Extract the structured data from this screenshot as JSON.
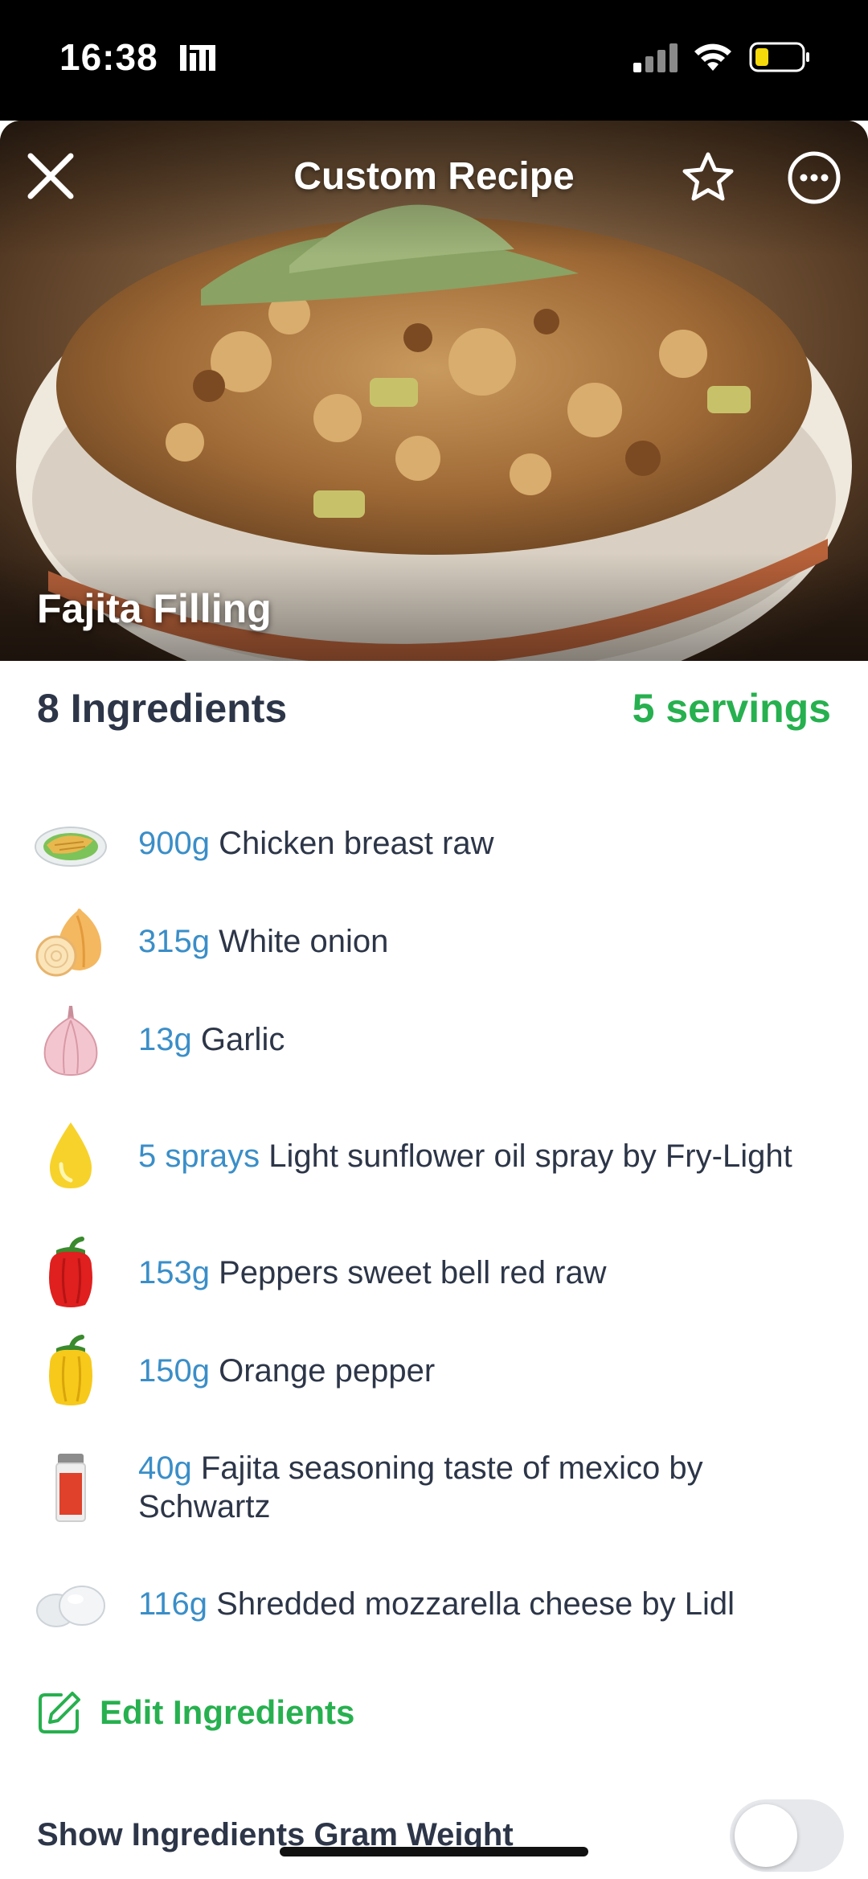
{
  "status_bar": {
    "time": "16:38"
  },
  "header": {
    "title": "Custom Recipe",
    "close_icon": "close-icon",
    "favorite_icon": "star-outline-icon",
    "more_icon": "more-horizontal-icon"
  },
  "recipe": {
    "name": "Fajita Filling",
    "ingredient_count_label": "8 Ingredients",
    "servings_label": "5 servings"
  },
  "ingredients": [
    {
      "amount": "900g",
      "name": "Chicken breast raw",
      "icon": "chicken-icon"
    },
    {
      "amount": "315g",
      "name": "White onion",
      "icon": "onion-icon"
    },
    {
      "amount": "13g",
      "name": "Garlic",
      "icon": "garlic-icon"
    },
    {
      "amount": "5 sprays",
      "name": "Light sunflower oil spray by Fry-Light",
      "icon": "oil-drop-icon"
    },
    {
      "amount": "153g",
      "name": "Peppers sweet bell red raw",
      "icon": "red-pepper-icon"
    },
    {
      "amount": "150g",
      "name": "Orange pepper",
      "icon": "yellow-pepper-icon"
    },
    {
      "amount": "40g",
      "name": "Fajita seasoning taste of mexico by Schwartz",
      "icon": "spice-jar-icon"
    },
    {
      "amount": "116g",
      "name": "Shredded mozzarella cheese by Lidl",
      "icon": "mozzarella-icon"
    }
  ],
  "actions": {
    "edit_ingredients_label": "Edit Ingredients",
    "edit_icon": "edit-icon"
  },
  "settings": {
    "show_gram_weight_label": "Show Ingredients Gram Weight",
    "show_gram_weight_enabled": false
  },
  "colors": {
    "accent_green": "#27b04f",
    "amount_blue": "#3a8ec8",
    "text_dark": "#2d3648"
  }
}
